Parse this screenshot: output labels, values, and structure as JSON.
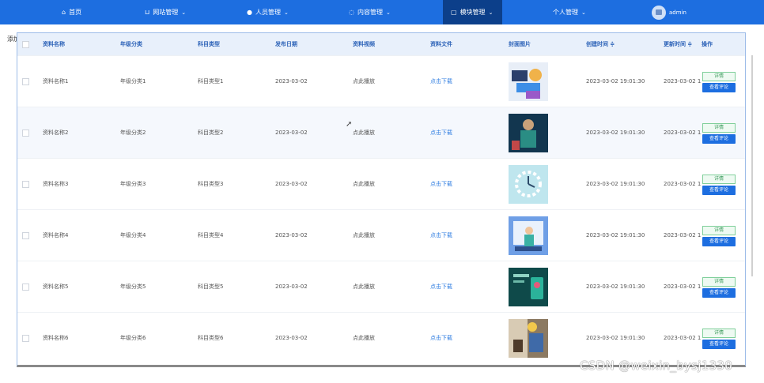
{
  "nav": {
    "home": "首页",
    "site_manage": "网站管理",
    "people_manage": "人员管理",
    "content_manage": "内容管理",
    "module_manage": "模块管理",
    "personal_manage": "个人管理",
    "user": "admin"
  },
  "left_cut_text": "添加",
  "table": {
    "headers": {
      "name": "资料名称",
      "grade": "年级分类",
      "subject": "科目类型",
      "publish_date": "发布日期",
      "video": "资料视频",
      "file": "资料文件",
      "cover": "封面图片",
      "created": "创建时间 ≑",
      "updated": "更新时间 ≑",
      "actions": "操作"
    },
    "rows": [
      {
        "name": "资料名称1",
        "grade": "年级分类1",
        "subject": "科目类型1",
        "date": "2023-03-02",
        "video": "点此播放",
        "file": "点击下载",
        "created": "2023-03-02 19:01:30",
        "updated": "2023-03-02 1"
      },
      {
        "name": "资料名称2",
        "grade": "年级分类2",
        "subject": "科目类型2",
        "date": "2023-03-02",
        "video": "点此播放",
        "file": "点击下载",
        "created": "2023-03-02 19:01:30",
        "updated": "2023-03-02 1"
      },
      {
        "name": "资料名称3",
        "grade": "年级分类3",
        "subject": "科目类型3",
        "date": "2023-03-02",
        "video": "点此播放",
        "file": "点击下载",
        "created": "2023-03-02 19:01:30",
        "updated": "2023-03-02 1"
      },
      {
        "name": "资料名称4",
        "grade": "年级分类4",
        "subject": "科目类型4",
        "date": "2023-03-02",
        "video": "点此播放",
        "file": "点击下载",
        "created": "2023-03-02 19:01:30",
        "updated": "2023-03-02 1"
      },
      {
        "name": "资料名称5",
        "grade": "年级分类5",
        "subject": "科目类型5",
        "date": "2023-03-02",
        "video": "点此播放",
        "file": "点击下载",
        "created": "2023-03-02 19:01:30",
        "updated": "2023-03-02 1"
      },
      {
        "name": "资料名称6",
        "grade": "年级分类6",
        "subject": "科目类型6",
        "date": "2023-03-02",
        "video": "点此播放",
        "file": "点击下载",
        "created": "2023-03-02 19:01:30",
        "updated": "2023-03-02 1"
      }
    ],
    "detail_label": "详情",
    "review_label": "查看评论"
  },
  "watermark": "CSDN @weixin_bysj1330",
  "colors": {
    "nav_bg": "#1d6ee0",
    "nav_active": "#0c3f8a",
    "header_bg": "#e8f0fb",
    "link": "#2f7de1",
    "detail_green": "#3a9a5a"
  }
}
